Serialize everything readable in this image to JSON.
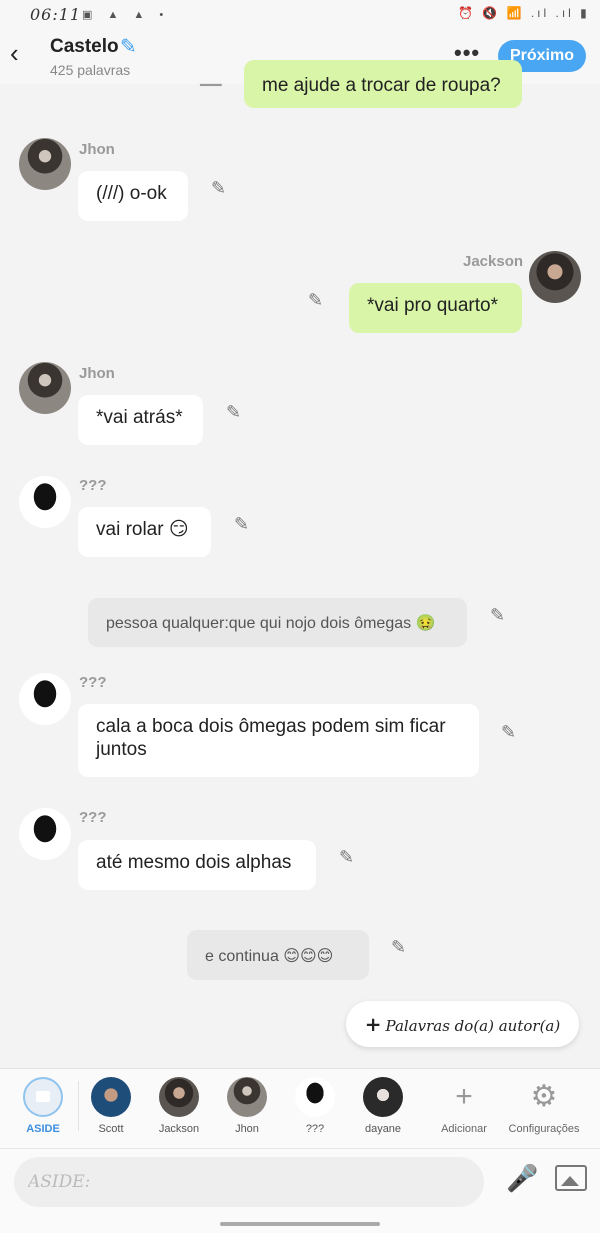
{
  "status_bar": {
    "time": "06:11",
    "left_icons": "▣ ▲ ▲ •",
    "right_icons": "⏰ 🔇 📶 .ıl .ıl ▮"
  },
  "header": {
    "title": "Castelo",
    "subtitle": "425 palavras",
    "next_label": "Próximo",
    "more_icon": "•••"
  },
  "messages": [
    {
      "type": "right",
      "text": "me ajude a trocar de roupa?"
    },
    {
      "type": "left",
      "name": "Jhon",
      "text": "(///) o-ok"
    },
    {
      "type": "right",
      "name": "Jackson",
      "text": "*vai pro quarto*"
    },
    {
      "type": "left",
      "name": "Jhon",
      "text": "*vai atrás*"
    },
    {
      "type": "left",
      "name": "???",
      "text": "vai rolar 😏"
    },
    {
      "type": "aside",
      "text": "pessoa qualquer:que qui nojo dois ômegas 🤢"
    },
    {
      "type": "left",
      "name": "???",
      "text": "cala a boca dois ômegas podem sim ficar juntos"
    },
    {
      "type": "left",
      "name": "???",
      "text": "até mesmo dois alphas"
    },
    {
      "type": "aside",
      "text": "e continua 😊😊😊"
    }
  ],
  "author_words_button": {
    "plus": "+",
    "label": "Palavras do(a) autor(a)"
  },
  "characters": [
    {
      "name": "ASIDE",
      "selected": true
    },
    {
      "name": "Scott"
    },
    {
      "name": "Jackson"
    },
    {
      "name": "Jhon"
    },
    {
      "name": "???"
    },
    {
      "name": "dayane"
    }
  ],
  "tools": {
    "add_label": "Adicionar",
    "add_icon": "+",
    "settings_label": "Configurações",
    "settings_icon": "⚙"
  },
  "input": {
    "placeholder": "ASIDE:"
  },
  "colors": {
    "accent": "#49a6f2",
    "green_bubble": "#d9f5a8",
    "background": "#f3f3f3"
  }
}
